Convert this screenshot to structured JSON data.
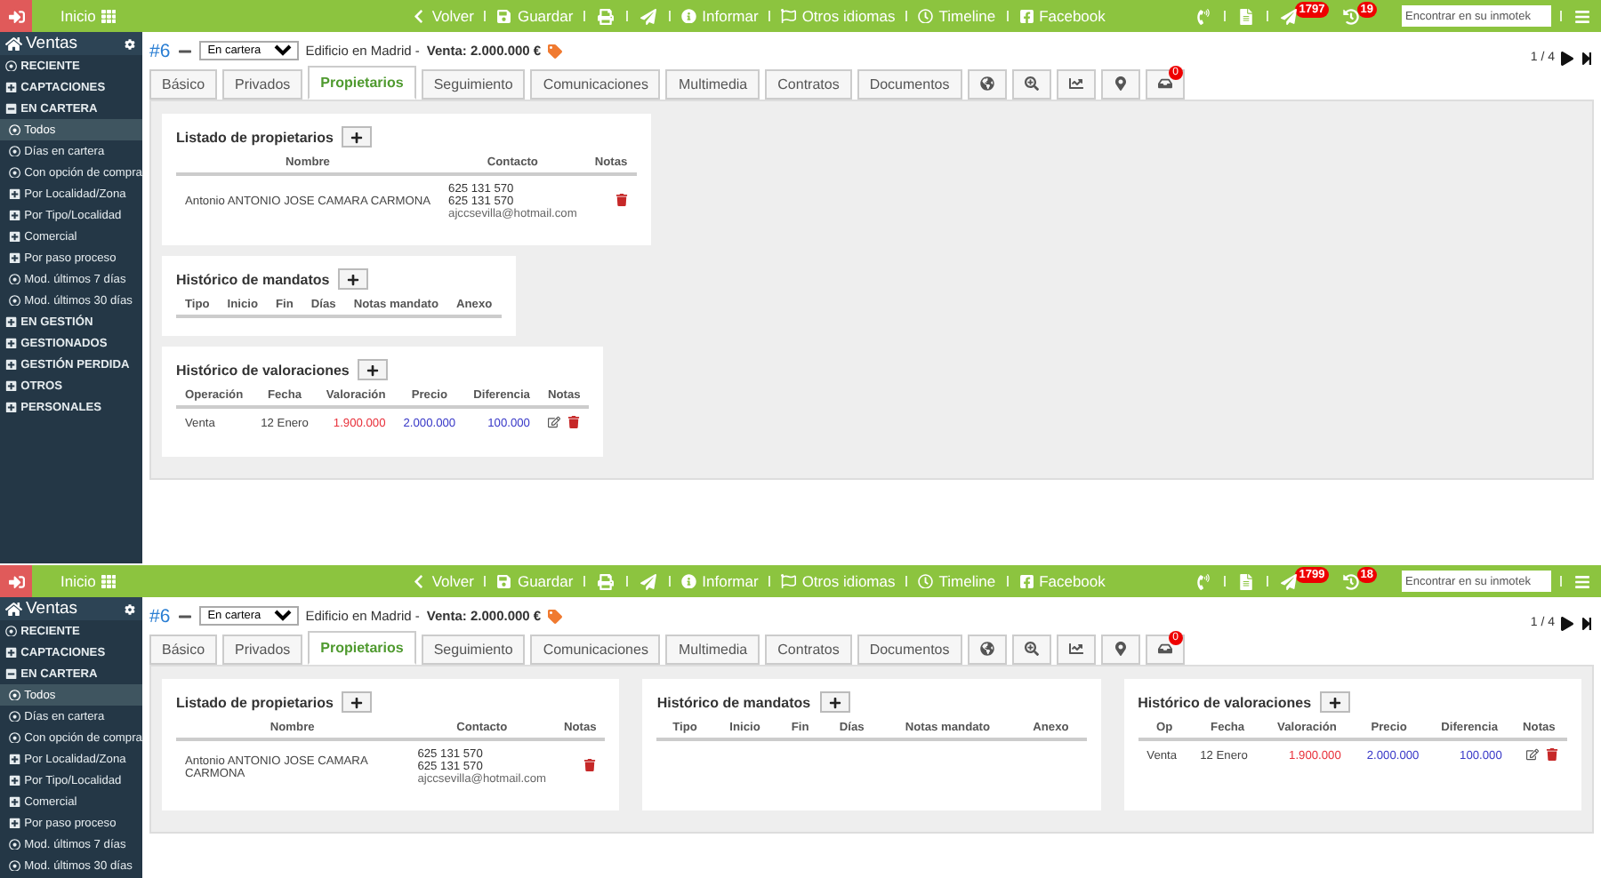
{
  "screens": [
    {
      "toolbar": {
        "home": "Inicio",
        "items": [
          {
            "kind": "button",
            "label": "Volver"
          },
          {
            "kind": "button",
            "label": "Guardar"
          },
          {
            "kind": "icon"
          },
          {
            "kind": "icon"
          },
          {
            "kind": "button",
            "label": "Informar"
          },
          {
            "kind": "button",
            "label": "Otros idiomas"
          },
          {
            "kind": "button",
            "label": "Timeline"
          },
          {
            "kind": "button",
            "label": "Facebook"
          }
        ],
        "notifications": [
          {
            "count": "1797"
          },
          {
            "count": "19"
          }
        ],
        "search": {
          "placeholder": "Encontrar en su inmotek"
        }
      },
      "sidebar": {
        "title": "Ventas",
        "items": [
          {
            "label": "RECIENTE",
            "kind": "link",
            "selected": false
          },
          {
            "label": "CAPTACIONES",
            "kind": "group",
            "expanded": false,
            "selected": false
          },
          {
            "label": "EN CARTERA",
            "kind": "group",
            "expanded": true,
            "selected": false,
            "children": [
              {
                "label": "Todos",
                "kind": "link",
                "selected": true
              },
              {
                "label": "Días en cartera",
                "kind": "link",
                "selected": false
              },
              {
                "label": "Con opción de compra",
                "kind": "link",
                "selected": false
              },
              {
                "label": "Por Localidad/Zona",
                "kind": "group",
                "expanded": false,
                "selected": false
              },
              {
                "label": "Por Tipo/Localidad",
                "kind": "group",
                "expanded": false,
                "selected": false
              },
              {
                "label": "Comercial",
                "kind": "group",
                "expanded": false,
                "selected": false
              },
              {
                "label": "Por paso proceso",
                "kind": "group",
                "expanded": false,
                "selected": false
              },
              {
                "label": "Mod. últimos 7 días",
                "kind": "link",
                "selected": false
              },
              {
                "label": "Mod. últimos 30 días",
                "kind": "link",
                "selected": false
              }
            ]
          },
          {
            "label": "EN GESTIÓN",
            "kind": "group",
            "expanded": false,
            "selected": false
          },
          {
            "label": "GESTIONADOS",
            "kind": "group",
            "expanded": false,
            "selected": false
          },
          {
            "label": "GESTIÓN PERDIDA",
            "kind": "group",
            "expanded": false,
            "selected": false
          },
          {
            "label": "OTROS",
            "kind": "group",
            "expanded": false,
            "selected": false
          },
          {
            "label": "PERSONALES",
            "kind": "group",
            "expanded": false,
            "selected": false
          }
        ]
      },
      "record": {
        "id": "#6",
        "status": "En cartera",
        "title": "Edificio en Madrid -",
        "price": "Venta: 2.000.000 €",
        "pager": "1 / 4"
      },
      "tabs": [
        {
          "label": "Básico",
          "selected": false
        },
        {
          "label": "Privados",
          "selected": false
        },
        {
          "label": "Propietarios",
          "selected": true
        },
        {
          "label": "Seguimiento",
          "selected": false
        },
        {
          "label": "Comunicaciones",
          "selected": false
        },
        {
          "label": "Multimedia",
          "selected": false
        },
        {
          "label": "Contratos",
          "selected": false
        },
        {
          "label": "Documentos",
          "selected": false
        }
      ],
      "icon_tabs": [
        {
          "selected": false
        },
        {
          "selected": false
        },
        {
          "selected": false
        },
        {
          "selected": false
        },
        {
          "selected": false,
          "badge": "0"
        }
      ],
      "cards": [
        {
          "title": "Listado de propietarios",
          "columns": [
            "Nombre",
            "Contacto",
            "Notas"
          ],
          "rows": [
            {
              "editable": false,
              "cells": [
                {
                  "text": "Antonio ANTONIO JOSE CAMARA CARMONA"
                },
                {
                  "lines": [
                    "625 131 570",
                    "625 131 570",
                    "ajccsevilla@hotmail.com"
                  ]
                }
              ]
            }
          ]
        },
        {
          "title": "Histórico de mandatos",
          "columns": [
            "Tipo",
            "Inicio",
            "Fin",
            "Días",
            "Notas mandato",
            "Anexo"
          ]
        },
        {
          "title": "Histórico de valoraciones",
          "columns": [
            "Operación",
            "Fecha",
            "Valoración",
            "Precio",
            "Diferencia",
            "Notas"
          ],
          "rows": [
            {
              "editable": true,
              "cells": [
                {
                  "text": "Venta"
                },
                {
                  "text": "12 Enero"
                },
                {
                  "text": "1.900.000",
                  "color": "#e8323c"
                },
                {
                  "text": "2.000.000",
                  "color": "#3a3ac8"
                },
                {
                  "text": "100.000",
                  "color": "#3a3ac8"
                }
              ]
            }
          ]
        }
      ]
    },
    {
      "toolbar": {
        "home": "Inicio",
        "items": [
          {
            "kind": "button",
            "label": "Volver"
          },
          {
            "kind": "button",
            "label": "Guardar"
          },
          {
            "kind": "icon"
          },
          {
            "kind": "icon"
          },
          {
            "kind": "button",
            "label": "Informar"
          },
          {
            "kind": "button",
            "label": "Otros idiomas"
          },
          {
            "kind": "button",
            "label": "Timeline"
          },
          {
            "kind": "button",
            "label": "Facebook"
          }
        ],
        "notifications": [
          {
            "count": "1799"
          },
          {
            "count": "18"
          }
        ],
        "search": {
          "placeholder": "Encontrar en su inmotek"
        }
      },
      "sidebar": {
        "title": "Ventas",
        "items": [
          {
            "label": "RECIENTE",
            "kind": "link",
            "selected": false
          },
          {
            "label": "CAPTACIONES",
            "kind": "group",
            "expanded": false,
            "selected": false
          },
          {
            "label": "EN CARTERA",
            "kind": "group",
            "expanded": true,
            "selected": false,
            "children": [
              {
                "label": "Todos",
                "kind": "link",
                "selected": true
              },
              {
                "label": "Días en cartera",
                "kind": "link",
                "selected": false
              },
              {
                "label": "Con opción de compra",
                "kind": "link",
                "selected": false
              },
              {
                "label": "Por Localidad/Zona",
                "kind": "group",
                "expanded": false,
                "selected": false
              },
              {
                "label": "Por Tipo/Localidad",
                "kind": "group",
                "expanded": false,
                "selected": false
              },
              {
                "label": "Comercial",
                "kind": "group",
                "expanded": false,
                "selected": false
              },
              {
                "label": "Por paso proceso",
                "kind": "group",
                "expanded": false,
                "selected": false
              },
              {
                "label": "Mod. últimos 7 días",
                "kind": "link",
                "selected": false
              },
              {
                "label": "Mod. últimos 30 días",
                "kind": "link",
                "selected": false
              }
            ]
          }
        ]
      },
      "record": {
        "id": "#6",
        "status": "En cartera",
        "title": "Edificio en Madrid -",
        "price": "Venta: 2.000.000 €",
        "pager": "1 / 4"
      },
      "tabs": [
        {
          "label": "Básico",
          "selected": false
        },
        {
          "label": "Privados",
          "selected": false
        },
        {
          "label": "Propietarios",
          "selected": true
        },
        {
          "label": "Seguimiento",
          "selected": false
        },
        {
          "label": "Comunicaciones",
          "selected": false
        },
        {
          "label": "Multimedia",
          "selected": false
        },
        {
          "label": "Contratos",
          "selected": false
        },
        {
          "label": "Documentos",
          "selected": false
        }
      ],
      "icon_tabs": [
        {
          "selected": false
        },
        {
          "selected": false
        },
        {
          "selected": false
        },
        {
          "selected": false
        },
        {
          "selected": false,
          "badge": "0"
        }
      ],
      "cards": [
        {
          "title": "Listado de propietarios",
          "columns": [
            "Nombre",
            "Contacto",
            "Notas"
          ],
          "rows": [
            {
              "editable": false,
              "cells": [
                {
                  "text": "Antonio ANTONIO JOSE CAMARA CARMONA"
                },
                {
                  "lines": [
                    "625 131 570",
                    "625 131 570",
                    "ajccsevilla@hotmail.com"
                  ]
                }
              ]
            }
          ]
        },
        {
          "title": "Histórico de mandatos",
          "columns": [
            "Tipo",
            "Inicio",
            "Fin",
            "Días",
            "Notas mandato",
            "Anexo"
          ]
        },
        {
          "title": "Histórico de valoraciones",
          "columns": [
            "Op",
            "Fecha",
            "Valoración",
            "Precio",
            "Diferencia",
            "Notas"
          ],
          "rows": [
            {
              "editable": true,
              "cells": [
                {
                  "text": "Venta"
                },
                {
                  "text": "12 Enero"
                },
                {
                  "text": "1.900.000",
                  "color": "#e8323c"
                },
                {
                  "text": "2.000.000",
                  "color": "#3a3ac8"
                },
                {
                  "text": "100.000",
                  "color": "#3a3ac8"
                }
              ]
            }
          ]
        }
      ]
    }
  ]
}
